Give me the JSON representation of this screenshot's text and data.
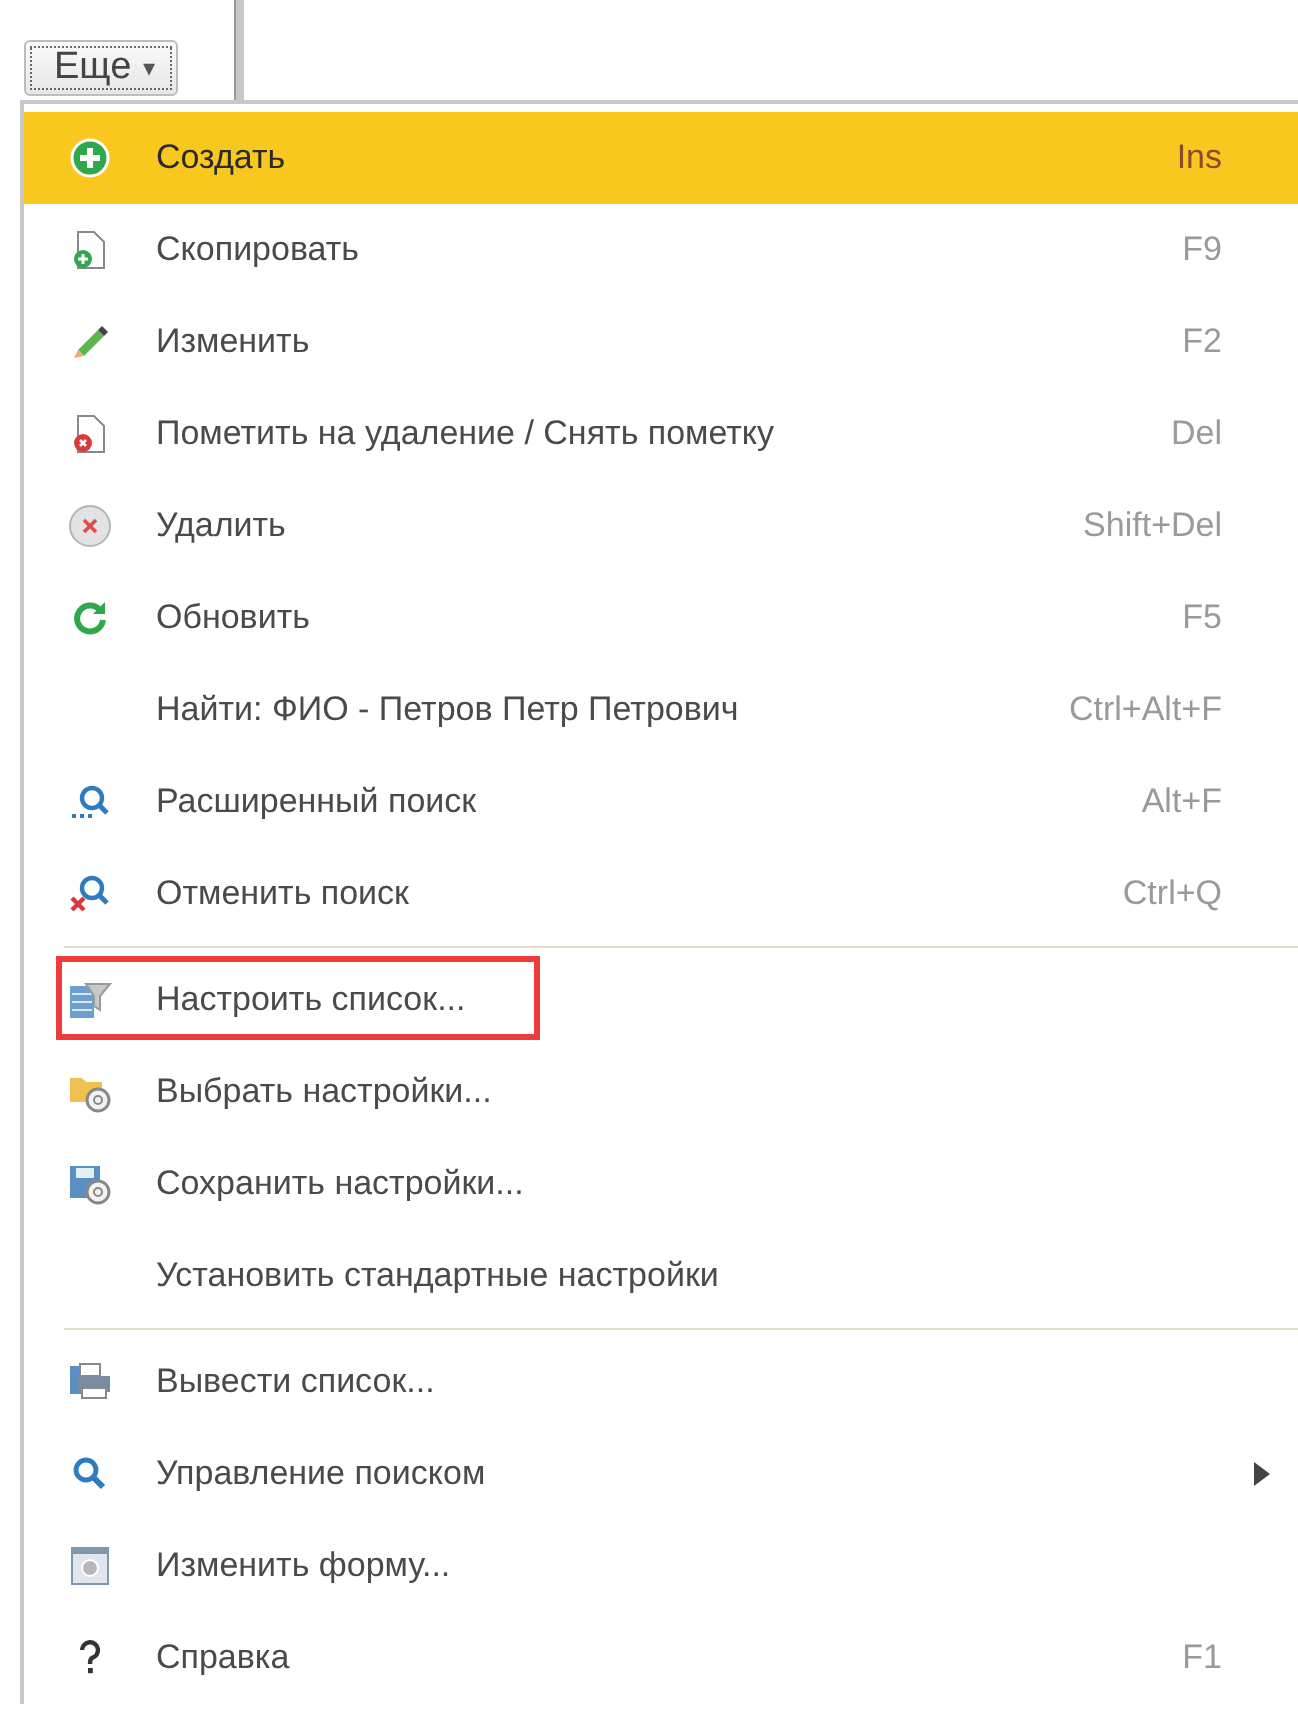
{
  "more_button": {
    "label": "Еще",
    "caret": "▾"
  },
  "menu": {
    "groups": [
      {
        "items": [
          {
            "label": "Создать",
            "shortcut": "Ins",
            "selected": true,
            "highlighted": false
          },
          {
            "label": "Скопировать",
            "shortcut": "F9",
            "selected": false,
            "highlighted": false
          },
          {
            "label": "Изменить",
            "shortcut": "F2",
            "selected": false,
            "highlighted": false
          },
          {
            "label": "Пометить на удаление / Снять пометку",
            "shortcut": "Del",
            "selected": false,
            "highlighted": false
          },
          {
            "label": "Удалить",
            "shortcut": "Shift+Del",
            "selected": false,
            "highlighted": false
          },
          {
            "label": "Обновить",
            "shortcut": "F5",
            "selected": false,
            "highlighted": false
          },
          {
            "label": "Найти: ФИО - Петров Петр Петрович",
            "shortcut": "Ctrl+Alt+F",
            "selected": false,
            "highlighted": false
          },
          {
            "label": "Расширенный поиск",
            "shortcut": "Alt+F",
            "selected": false,
            "highlighted": false
          },
          {
            "label": "Отменить поиск",
            "shortcut": "Ctrl+Q",
            "selected": false,
            "highlighted": false
          }
        ]
      },
      {
        "items": [
          {
            "label": "Настроить список...",
            "selected": false,
            "highlighted": true
          },
          {
            "label": "Выбрать настройки...",
            "selected": false,
            "highlighted": false
          },
          {
            "label": "Сохранить настройки...",
            "selected": false,
            "highlighted": false
          },
          {
            "label": "Установить стандартные настройки",
            "selected": false,
            "highlighted": false
          }
        ]
      },
      {
        "items": [
          {
            "label": "Вывести список...",
            "selected": false,
            "highlighted": false
          },
          {
            "label": "Управление поиском",
            "submenu": true,
            "selected": false,
            "highlighted": false
          },
          {
            "label": "Изменить форму...",
            "selected": false,
            "highlighted": false
          },
          {
            "label": "Справка",
            "shortcut": "F1",
            "selected": false,
            "highlighted": false
          }
        ]
      }
    ]
  }
}
